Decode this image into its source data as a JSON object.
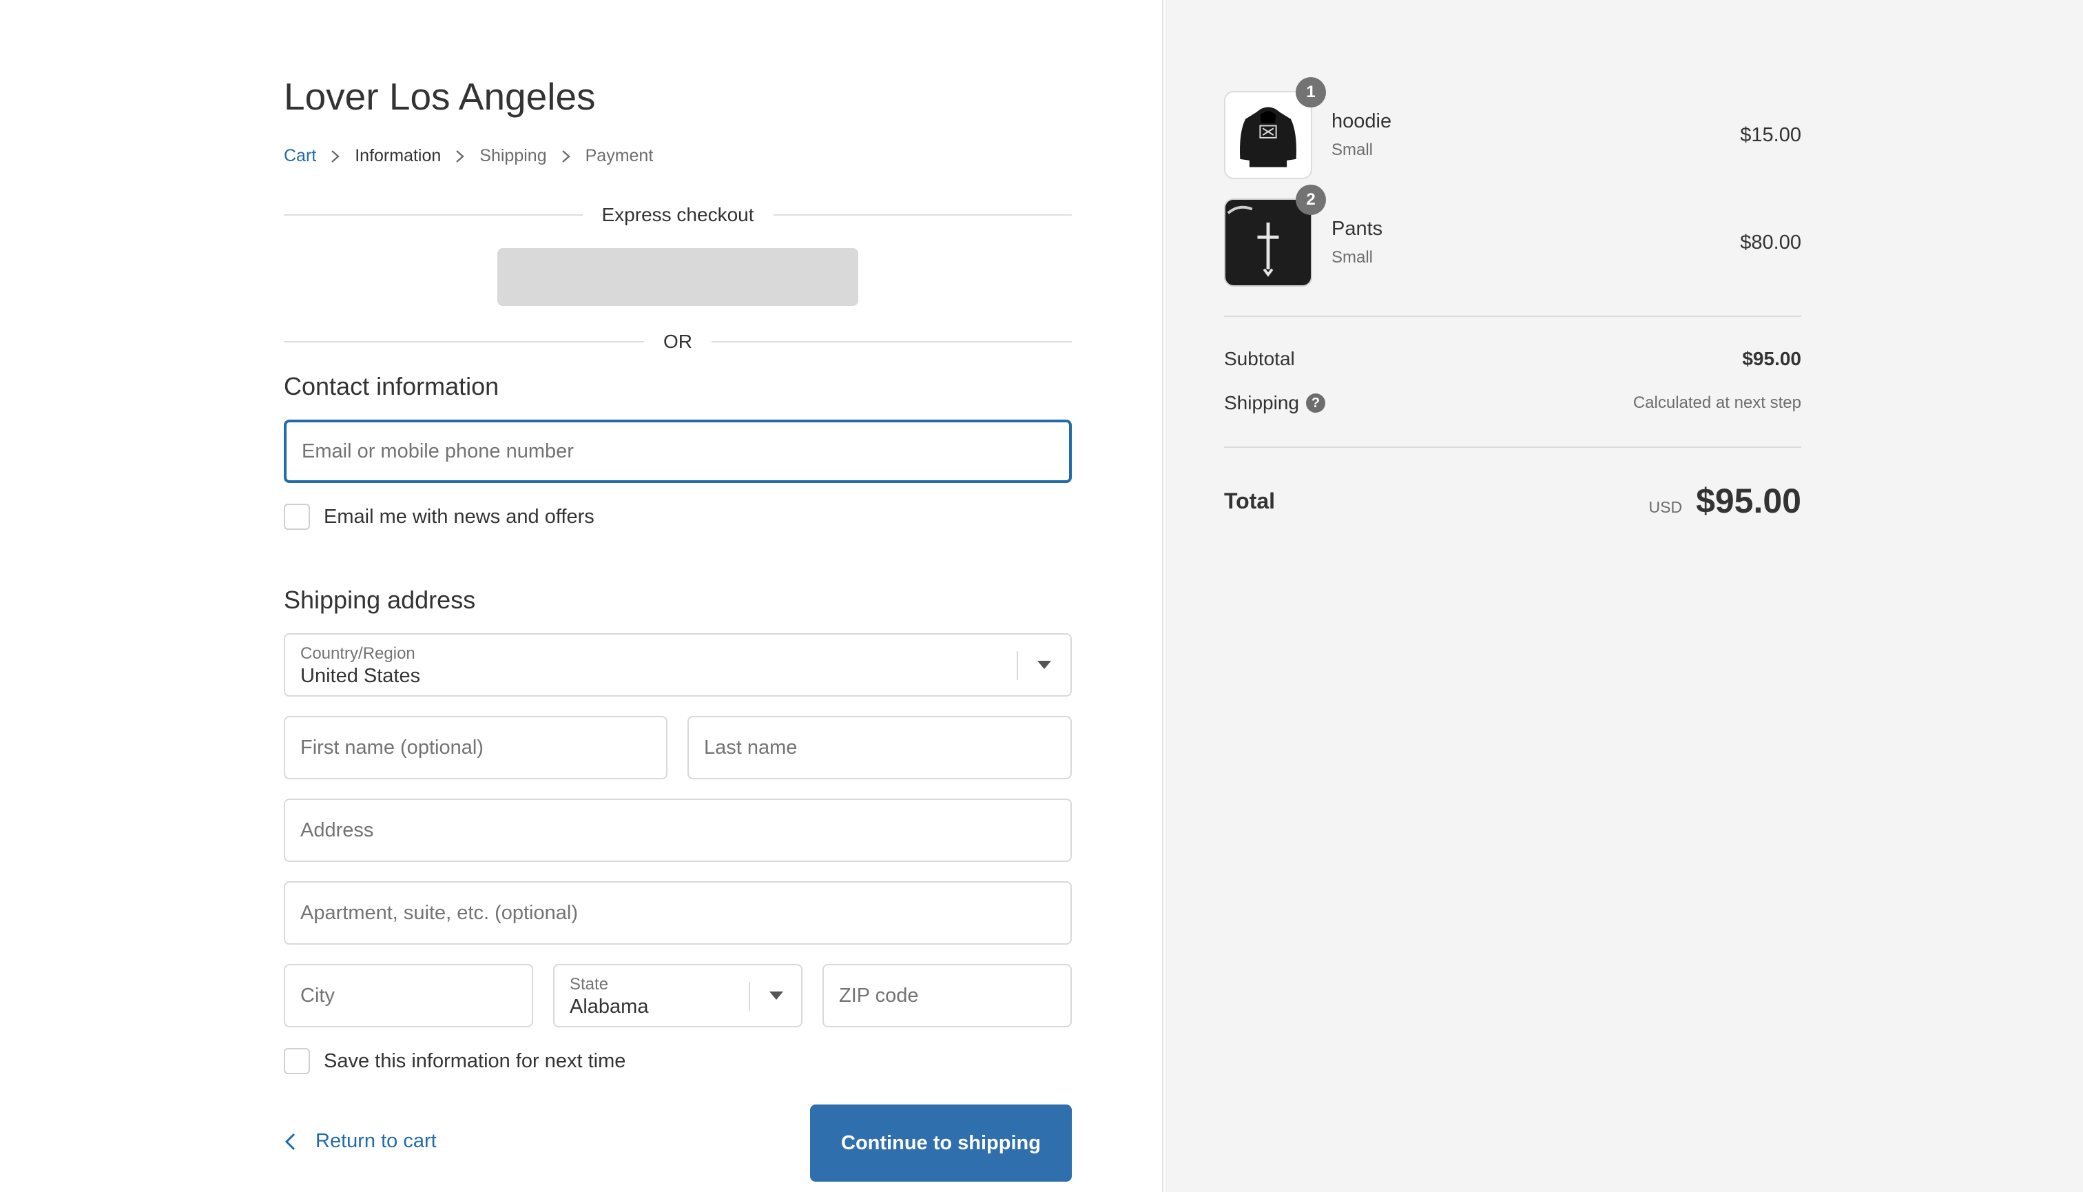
{
  "store": {
    "title": "Lover Los Angeles"
  },
  "breadcrumb": {
    "cart": "Cart",
    "information": "Information",
    "shipping": "Shipping",
    "payment": "Payment"
  },
  "express": {
    "label": "Express checkout",
    "or": "OR"
  },
  "contact": {
    "title": "Contact information",
    "email_placeholder": "Email or mobile phone number",
    "email_value": "",
    "newsletter_label": "Email me with news and offers"
  },
  "shipping_address": {
    "title": "Shipping address",
    "country_label": "Country/Region",
    "country_value": "United States",
    "first_name_placeholder": "First name (optional)",
    "last_name_placeholder": "Last name",
    "address_placeholder": "Address",
    "apartment_placeholder": "Apartment, suite, etc. (optional)",
    "city_placeholder": "City",
    "state_label": "State",
    "state_value": "Alabama",
    "zip_placeholder": "ZIP code",
    "save_info_label": "Save this information for next time"
  },
  "actions": {
    "return_label": "Return to cart",
    "continue_label": "Continue to shipping"
  },
  "order": {
    "items": [
      {
        "name": "hoodie",
        "variant": "Small",
        "price": "$15.00",
        "quantity": "1",
        "icon": "hoodie-image"
      },
      {
        "name": "Pants",
        "variant": "Small",
        "price": "$80.00",
        "quantity": "2",
        "icon": "pants-image"
      }
    ],
    "subtotal_label": "Subtotal",
    "subtotal_value": "$95.00",
    "shipping_label": "Shipping",
    "shipping_help": "?",
    "shipping_value": "Calculated at next step",
    "total_label": "Total",
    "currency": "USD",
    "total_value": "$95.00"
  },
  "colors": {
    "accent": "#1f6bab",
    "button": "#2f6fad",
    "sidebar_bg": "#f4f4f4"
  }
}
